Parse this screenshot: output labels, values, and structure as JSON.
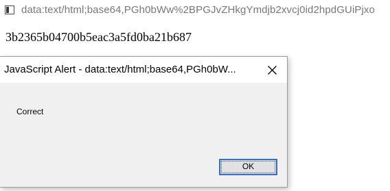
{
  "window": {
    "title": "data:text/html;base64,PGh0bWw%2BPGJvZHkgYmdjb2xvcj0id2hpdGUiPjxo",
    "icon": "page-icon"
  },
  "page": {
    "text": "3b2365b04700b5eac3a5fd0ba21b687"
  },
  "alert": {
    "title": "JavaScript Alert - data:text/html;base64,PGh0bW...",
    "message": "Correct",
    "ok_label": "OK",
    "close_icon": "close-icon",
    "accent_color": "#2b6fd6"
  }
}
